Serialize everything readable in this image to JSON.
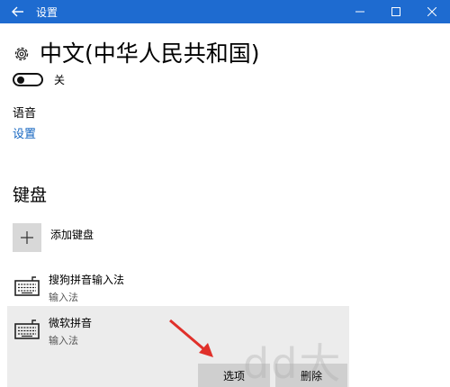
{
  "window": {
    "title": "设置",
    "back_icon": "arrow-left-icon",
    "controls": [
      "minimize-icon",
      "maximize-icon",
      "close-icon"
    ]
  },
  "page": {
    "icon": "gear-icon",
    "title": "中文(中华人民共和国)"
  },
  "toggle": {
    "state_label": "关",
    "on": false
  },
  "speech": {
    "label": "语音",
    "link": "设置"
  },
  "keyboards": {
    "heading": "键盘",
    "add_label": "添加键盘",
    "items": [
      {
        "name": "搜狗拼音输入法",
        "type": "输入法",
        "selected": false
      },
      {
        "name": "微软拼音",
        "type": "输入法",
        "selected": true
      }
    ],
    "options_button": "选项",
    "remove_button": "删除"
  },
  "colors": {
    "titlebar": "#1e6bd0",
    "link": "#1566c0",
    "arrow": "#e0302a"
  }
}
